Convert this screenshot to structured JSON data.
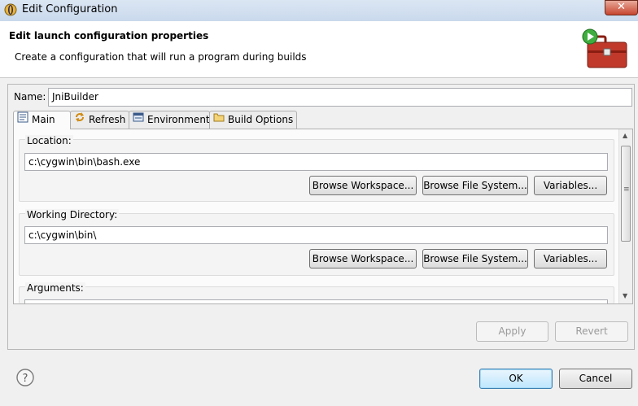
{
  "window": {
    "title": "Edit Configuration"
  },
  "header": {
    "title": "Edit launch configuration properties",
    "description": "Create a configuration that will run a program during builds"
  },
  "name_field": {
    "label": "Name:",
    "value": "JniBuilder"
  },
  "tabs": [
    {
      "label": "Main",
      "icon": "main-tab-icon",
      "selected": true
    },
    {
      "label": "Refresh",
      "icon": "refresh-icon"
    },
    {
      "label": "Environment",
      "icon": "environment-icon"
    },
    {
      "label": "Build Options",
      "icon": "folder-icon"
    }
  ],
  "location": {
    "label": "Location:",
    "value": "c:\\cygwin\\bin\\bash.exe",
    "browse_workspace": "Browse Workspace...",
    "browse_file_system": "Browse File System...",
    "variables": "Variables..."
  },
  "working_directory": {
    "label": "Working Directory:",
    "value": "c:\\cygwin\\bin\\",
    "browse_workspace": "Browse Workspace...",
    "browse_file_system": "Browse File System...",
    "variables": "Variables..."
  },
  "arguments": {
    "label": "Arguments:"
  },
  "actions": {
    "apply": "Apply",
    "revert": "Revert"
  },
  "footer": {
    "ok": "OK",
    "cancel": "Cancel"
  },
  "colors": {
    "accent": "#3c7fb1",
    "toolbox": "#c0392b"
  }
}
